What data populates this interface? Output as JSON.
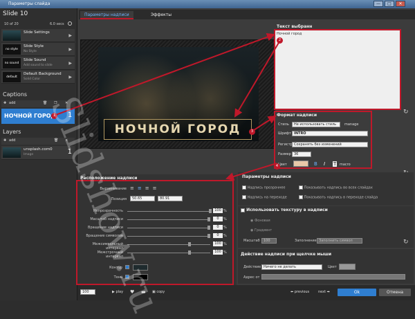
{
  "window": {
    "title": "Параметры слайда",
    "min": "—",
    "max": "□",
    "close": "✕"
  },
  "left": {
    "slide_title": "Slide 10",
    "counter": "10 of 20",
    "duration": "6.0 secs",
    "items": [
      {
        "thumb": "",
        "name": "Slide Settings",
        "sub": ""
      },
      {
        "thumb": "no style",
        "name": "Slide Style",
        "sub": "No Style"
      },
      {
        "thumb": "no sound",
        "name": "Slide Sound",
        "sub": "Add sound to slide"
      },
      {
        "thumb": "default",
        "name": "Default Background",
        "sub": "Solid Color"
      }
    ],
    "captions_header": "Captions",
    "add_label": "add",
    "caption_item": "НОЧНОЙ ГОРОД",
    "caption_num": "1",
    "layers_header": "Layers",
    "layer_name": "unsplash.com0",
    "layer_type": "Image",
    "layer_num": "1"
  },
  "tabs": [
    "Параметры надписи",
    "Эффекты"
  ],
  "caption_text": {
    "header": "Текст выбранн",
    "value": "Ночной город",
    "title_display": "НОЧНОЙ ГОРОД"
  },
  "format": {
    "header": "Формат надписи",
    "style_label": "Стиль",
    "style_value": "Не использовать стиль",
    "manage": "manage",
    "font_label": "Шрифт",
    "font_value": "INTRO",
    "case_label": "Регистр",
    "case_value": "Сохранять без изменений",
    "size_label": "Размер",
    "size_value": "36",
    "color_label": "Цвет",
    "color": "#e8c8a8",
    "macro": "macro"
  },
  "layout": {
    "header": "Расположение надписи",
    "align_label": "Выравнивание",
    "pos_label": "Позиция",
    "pos_x": "50.65",
    "pos_y": "80.91",
    "sliders": [
      {
        "label": "Непрозрачность",
        "value": "100",
        "unit": "%"
      },
      {
        "label": "Масштаб надписи",
        "value": "0",
        "unit": "%"
      },
      {
        "label": "Вращение надписи",
        "value": "0",
        "unit": "%"
      },
      {
        "label": "Вращение символов",
        "value": "0",
        "unit": "%"
      },
      {
        "label": "Межсимвольный интервал",
        "value": "100",
        "unit": "%"
      },
      {
        "label": "Межстрочный интервал",
        "value": "100",
        "unit": "%"
      }
    ],
    "outline_label": "Контур",
    "shadow_label": "Тень"
  },
  "params": {
    "header": "Параметры надписи",
    "opt1": "Надпись прозрачнее",
    "opt2": "Показывать надпись во всех слайдах",
    "opt3": "Надпись на переходе",
    "opt4": "Показывать надпись в переходе слайда"
  },
  "texture": {
    "header": "Использовать текстуру в надписи",
    "r1": "Фоновая",
    "r2": "Градиент",
    "scale_label": "Масштаб",
    "scale_value": "100",
    "fill_label": "Заполнение",
    "fill_value": "Заполнить символ"
  },
  "click": {
    "header": "Действие надписи при щелчке мыши",
    "action_label": "Действие",
    "action_value": "Ничего не делать",
    "color_label": "Цвет",
    "addr_label": "Адрес от"
  },
  "bottom": {
    "zoom": "100",
    "play": "play",
    "copy": "copy",
    "previous": "previous",
    "next": "next",
    "ok": "Ok",
    "cancel": "Отмена"
  },
  "watermark": "Slidshow.ru",
  "markers": [
    "1",
    "2",
    "3",
    "4"
  ],
  "colors": {
    "accent": "#2f7ed0",
    "highlight": "#c0182a"
  }
}
